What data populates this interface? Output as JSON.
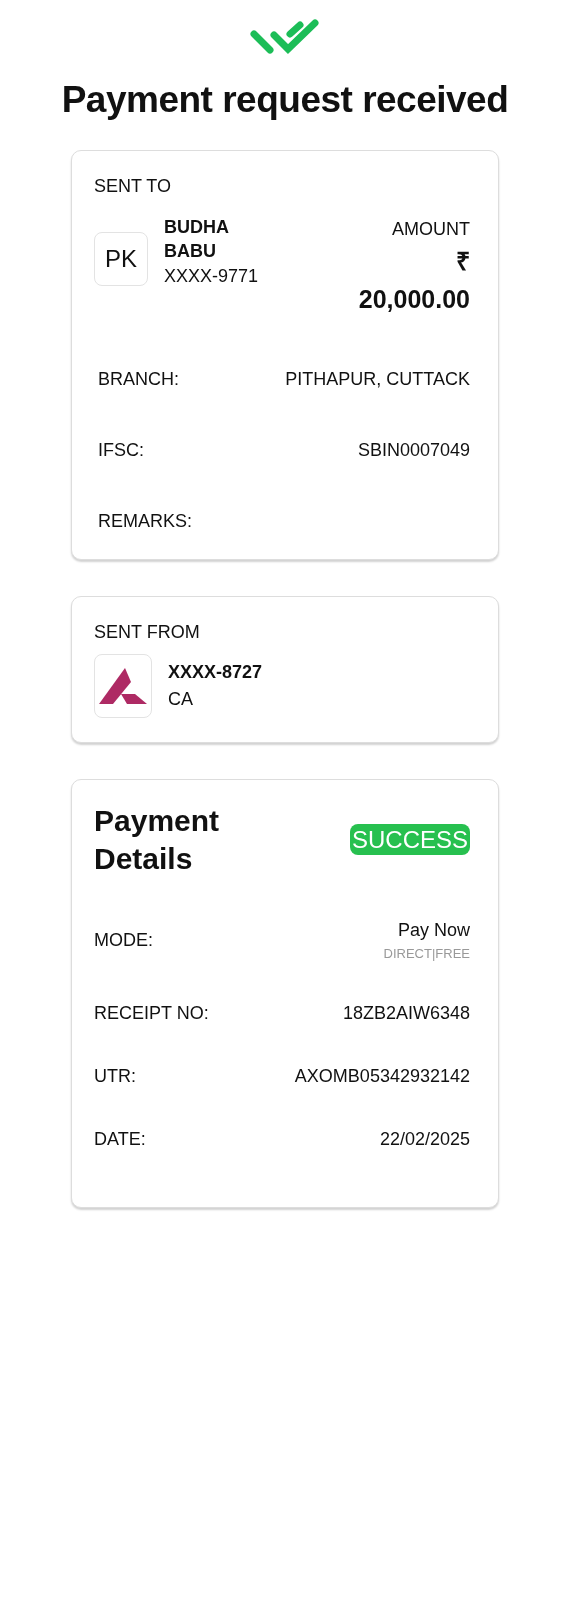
{
  "title": "Payment request received",
  "sent_to": {
    "heading": "SENT TO",
    "initials": "PK",
    "name": "BUDHA BABU",
    "account": "XXXX-9771",
    "amount_label": "AMOUNT",
    "currency": "₹",
    "amount": "20,000.00",
    "fields": [
      {
        "label": "BRANCH:",
        "value": "PITHAPUR, CUTTACK"
      },
      {
        "label": "IFSC:",
        "value": "SBIN0007049"
      },
      {
        "label": "REMARKS:"
      }
    ]
  },
  "sent_from": {
    "heading": "SENT FROM",
    "account": "XXXX-8727",
    "type": "CA"
  },
  "payment_details": {
    "title": "Payment Details",
    "status": {
      "label": "SUCCESS",
      "kind": "success"
    },
    "fields": [
      {
        "label": "MODE:",
        "value": "Pay Now",
        "note": "DIRECT|FREE"
      },
      {
        "label": "RECEIPT NO:",
        "value": "18ZB2AIW6348"
      },
      {
        "label": "UTR:",
        "value": "AXOMB05342932142"
      },
      {
        "label": "DATE:",
        "value": "22/02/2025"
      }
    ]
  }
}
